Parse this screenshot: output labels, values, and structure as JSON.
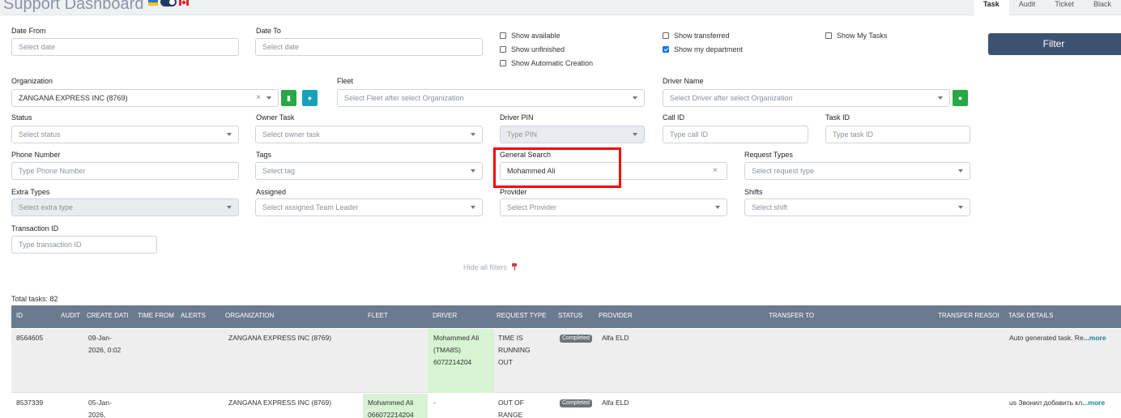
{
  "header": {
    "title": "Support Dashboard",
    "tabs": [
      "Task",
      "Audit",
      "Ticket",
      "Black"
    ]
  },
  "filters": {
    "date_from": {
      "label": "Date From",
      "placeholder": "Select date"
    },
    "date_to": {
      "label": "Date To",
      "placeholder": "Select date"
    },
    "checkboxes": {
      "show_available": {
        "label": "Show available",
        "checked": false
      },
      "show_unfinished": {
        "label": "Show unfinished",
        "checked": false
      },
      "show_automatic_creation": {
        "label": "Show Automatic Creation",
        "checked": false
      },
      "show_transferred": {
        "label": "Show transferred",
        "checked": false
      },
      "show_my_department": {
        "label": "Show my department",
        "checked": true
      },
      "show_my_tasks": {
        "label": "Show My Tasks",
        "checked": false
      }
    },
    "filter_button": "Filter",
    "organization": {
      "label": "Organization",
      "value": "ZANGANA EXPRESS INC (8769)",
      "clear": "×"
    },
    "fleet": {
      "label": "Fleet",
      "placeholder": "Select Fleet after select Organization"
    },
    "driver_name": {
      "label": "Driver Name",
      "placeholder": "Select Driver after select Organization"
    },
    "status": {
      "label": "Status",
      "placeholder": "Select status"
    },
    "owner_task": {
      "label": "Owner Task",
      "placeholder": "Select owner task"
    },
    "driver_pin": {
      "label": "Driver PIN",
      "placeholder": "Type PIN"
    },
    "call_id": {
      "label": "Call ID",
      "placeholder": "Type call ID"
    },
    "task_id": {
      "label": "Task ID",
      "placeholder": "Type task ID"
    },
    "phone_number": {
      "label": "Phone Number",
      "placeholder": "Type Phone Number"
    },
    "tags": {
      "label": "Tags",
      "placeholder": "Select tag"
    },
    "general_search": {
      "label": "General Search",
      "value": "Mohammed Ali",
      "clear": "×"
    },
    "request_types": {
      "label": "Request Types",
      "placeholder": "Select request type"
    },
    "extra_types": {
      "label": "Extra Types",
      "placeholder": "Select extra type"
    },
    "assigned": {
      "label": "Assigned",
      "placeholder": "Select assigned Team Leader"
    },
    "provider": {
      "label": "Provider",
      "placeholder": "Select Provider"
    },
    "shifts": {
      "label": "Shifts",
      "placeholder": "Select shift"
    },
    "transaction_id": {
      "label": "Transaction ID",
      "placeholder": "Type transaction ID"
    },
    "hide_all_filters": "Hide all filters"
  },
  "table": {
    "total": "Total tasks: 82",
    "columns": [
      "ID",
      "AUDIT",
      "CREATE DATI",
      "TIME FROM",
      "ALERTS",
      "ORGANIZATION",
      "FLEET",
      "DRIVER",
      "REQUEST TYPE",
      "STATUS",
      "PROVIDER",
      "TRANSFER TO",
      "TRANSFER REASOI",
      "TASK DETAILS"
    ],
    "rows": [
      {
        "id": "8564605",
        "create_date_1": "09-Jan-",
        "create_date_2": "2026, 0:02",
        "organization": "ZANGANA EXPRESS INC (8769)",
        "fleet_1": "",
        "fleet_2": "",
        "driver_1": "Mohammed Ali",
        "driver_2": "(TMA8S)",
        "driver_3": "6072214204",
        "request_type_1": "TIME IS",
        "request_type_2": "RUNNING",
        "request_type_3": "OUT",
        "status": "Completed",
        "provider": "Alfa ELD",
        "task_details": "Auto generated task. Re",
        "more": "...more"
      },
      {
        "id": "8537339",
        "create_date_1": "05-Jan-",
        "create_date_2": "2026,",
        "organization": "ZANGANA EXPRESS INC (8769)",
        "fleet_1": "Mohammed Ali",
        "fleet_2": "066072214204",
        "driver_1": "-",
        "request_type_1": "OUT OF",
        "request_type_2": "RANGE",
        "status": "Completed",
        "provider": "Alfa ELD",
        "task_details": "us Звонил добавить кл",
        "more": "...more"
      }
    ]
  }
}
